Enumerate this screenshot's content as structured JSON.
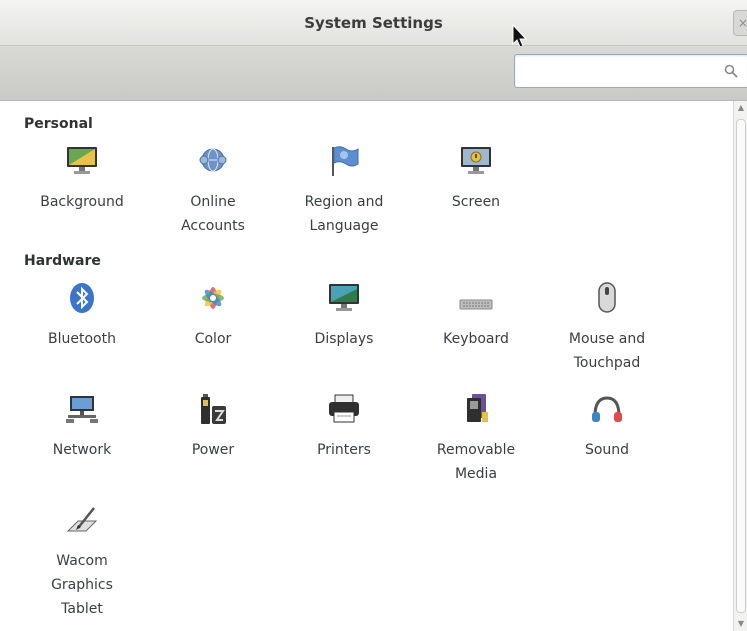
{
  "window": {
    "title": "System Settings",
    "close_glyph": "×"
  },
  "search": {
    "value": "",
    "placeholder": ""
  },
  "sections": [
    {
      "title": "Personal",
      "items": [
        {
          "label": "Background",
          "icon": "background-icon"
        },
        {
          "label": "Online\nAccounts",
          "icon": "online-accounts-icon"
        },
        {
          "label": "Region and\nLanguage",
          "icon": "region-language-icon"
        },
        {
          "label": "Screen",
          "icon": "screen-icon"
        }
      ]
    },
    {
      "title": "Hardware",
      "items": [
        {
          "label": "Bluetooth",
          "icon": "bluetooth-icon"
        },
        {
          "label": "Color",
          "icon": "color-icon"
        },
        {
          "label": "Displays",
          "icon": "displays-icon"
        },
        {
          "label": "Keyboard",
          "icon": "keyboard-icon"
        },
        {
          "label": "Mouse and\nTouchpad",
          "icon": "mouse-icon"
        },
        {
          "label": "Network",
          "icon": "network-icon"
        },
        {
          "label": "Power",
          "icon": "power-icon"
        },
        {
          "label": "Printers",
          "icon": "printer-icon"
        },
        {
          "label": "Removable\nMedia",
          "icon": "removable-media-icon"
        },
        {
          "label": "Sound",
          "icon": "sound-icon"
        },
        {
          "label": "Wacom\nGraphics\nTablet",
          "icon": "wacom-tablet-icon"
        }
      ]
    }
  ],
  "colors": {
    "accent": "#3b74c9",
    "text": "#2e3436"
  }
}
